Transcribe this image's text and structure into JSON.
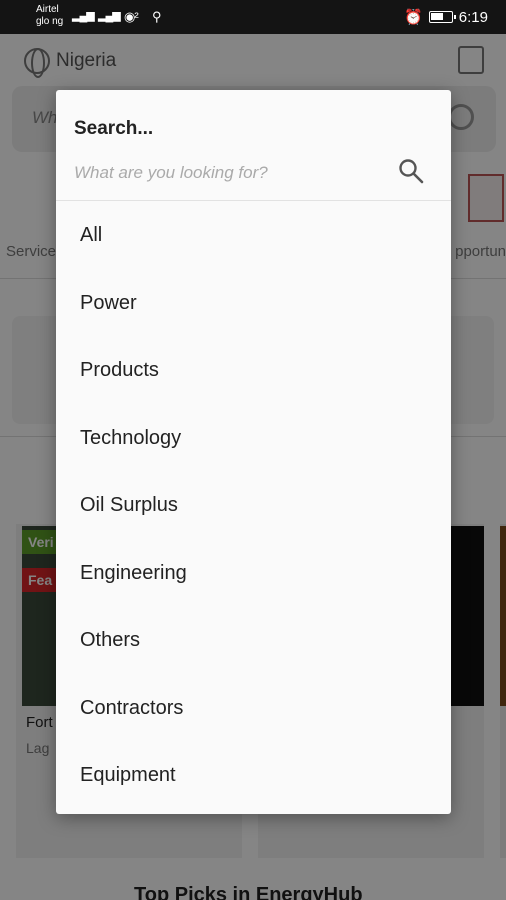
{
  "status_bar": {
    "carrier_line1": "Airtel",
    "carrier_line2": "glo ng",
    "time": "6:19"
  },
  "background": {
    "country": "Nigeria",
    "search_placeholder": "Wh",
    "category_left": "Service",
    "category_right": "pportun",
    "card_badge_verified": "Veri",
    "card_badge_featured": "Fea",
    "card_title": "Fort",
    "card_location": "Lag",
    "section_title": "Top Picks in EnergyHub"
  },
  "dialog": {
    "title": "Search...",
    "input_placeholder": "What are you looking for?",
    "input_value": "",
    "options": [
      {
        "label": "All"
      },
      {
        "label": "Power"
      },
      {
        "label": "Products"
      },
      {
        "label": "Technology"
      },
      {
        "label": "Oil Surplus"
      },
      {
        "label": "Engineering"
      },
      {
        "label": "Others"
      },
      {
        "label": "Contractors"
      },
      {
        "label": "Equipment"
      }
    ]
  }
}
